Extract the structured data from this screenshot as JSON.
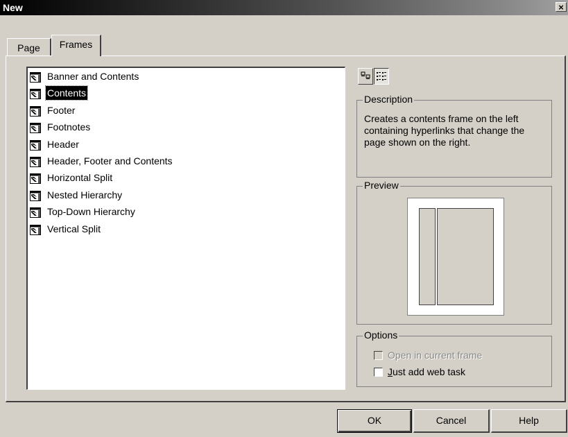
{
  "window": {
    "title": "New",
    "close_symbol": "×"
  },
  "tabs": [
    {
      "label": "Page",
      "active": false
    },
    {
      "label": "Frames",
      "active": true
    }
  ],
  "template_list": {
    "items": [
      {
        "label": "Banner and Contents",
        "icon": "frame-template-icon",
        "selected": false
      },
      {
        "label": "Contents",
        "icon": "frame-template-icon",
        "selected": true
      },
      {
        "label": "Footer",
        "icon": "frame-template-icon",
        "selected": false
      },
      {
        "label": "Footnotes",
        "icon": "frame-template-icon",
        "selected": false
      },
      {
        "label": "Header",
        "icon": "frame-template-icon",
        "selected": false
      },
      {
        "label": "Header, Footer and Contents",
        "icon": "frame-template-icon",
        "selected": false
      },
      {
        "label": "Horizontal Split",
        "icon": "frame-template-icon",
        "selected": false
      },
      {
        "label": "Nested Hierarchy",
        "icon": "frame-template-icon",
        "selected": false
      },
      {
        "label": "Top-Down Hierarchy",
        "icon": "frame-template-icon",
        "selected": false
      },
      {
        "label": "Vertical Split",
        "icon": "frame-template-icon",
        "selected": false
      }
    ]
  },
  "view_buttons": [
    {
      "icon": "large-icons-view-icon",
      "pressed": false
    },
    {
      "icon": "list-view-icon",
      "pressed": true
    }
  ],
  "description": {
    "legend": "Description",
    "text": "Creates a contents frame on the left containing hyperlinks that change the page shown on the right."
  },
  "preview": {
    "legend": "Preview"
  },
  "options": {
    "legend": "Options",
    "open_in_current_frame": {
      "label": "Open in current frame",
      "checked": false,
      "enabled": false
    },
    "just_add_web_task": {
      "label": "Just add web task",
      "checked": false,
      "enabled": true
    }
  },
  "buttons": {
    "ok": "OK",
    "cancel": "Cancel",
    "help": "Help"
  }
}
